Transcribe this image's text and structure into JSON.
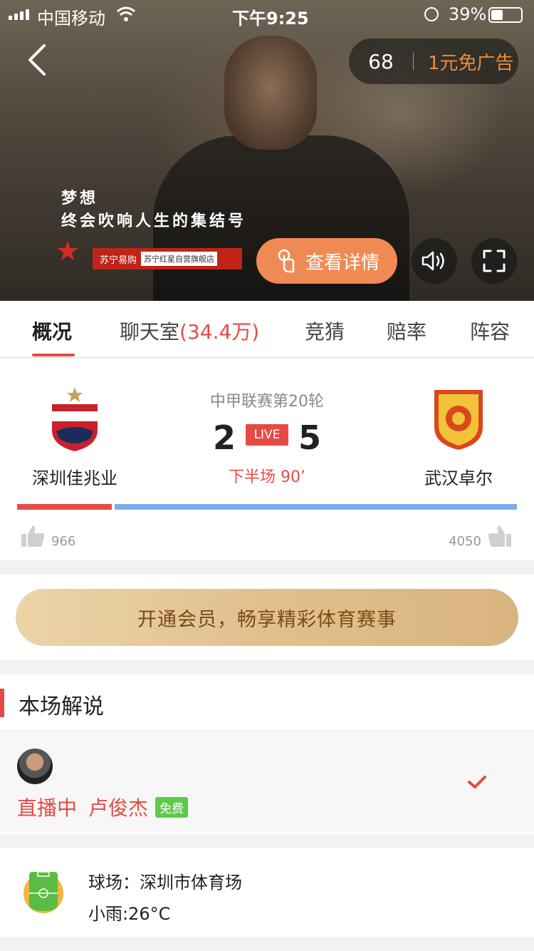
{
  "status_bar": {
    "carrier": "中国移动",
    "time": "下午9:25",
    "battery": "39%",
    "battery_level": 0.39
  },
  "video": {
    "ad_countdown": "68",
    "ad_free_label": "1元免广告",
    "tagline_line1": "梦想",
    "tagline_line2": "终会吹响人生的集结号",
    "banner_brand": "苏宁易购",
    "banner_store": "苏宁红星自营旗舰店",
    "detail_button": "查看详情"
  },
  "tabs": [
    {
      "label": "概况",
      "active": true
    },
    {
      "label": "聊天室",
      "count": "(34.4万)"
    },
    {
      "label": "竞猜"
    },
    {
      "label": "赔率"
    },
    {
      "label": "阵容"
    }
  ],
  "match": {
    "league": "中甲联赛第20轮",
    "home_team": "深圳佳兆业",
    "away_team": "武汉卓尔",
    "home_score": "2",
    "away_score": "5",
    "live_label": "LIVE",
    "period": "下半场 90’",
    "home_likes": "966",
    "away_likes": "4050",
    "home_support_fraction": 0.19,
    "colors": {
      "home": "#e54b46",
      "away": "#7aaeea"
    }
  },
  "member": {
    "button_label": "开通会员，畅享精彩体育赛事"
  },
  "commentary": {
    "section_title": "本场解说",
    "state": "直播中",
    "name": "卢俊杰",
    "badge": "免费"
  },
  "venue": {
    "name": "球场：深圳市体育场",
    "weather": "小雨:26°C"
  }
}
